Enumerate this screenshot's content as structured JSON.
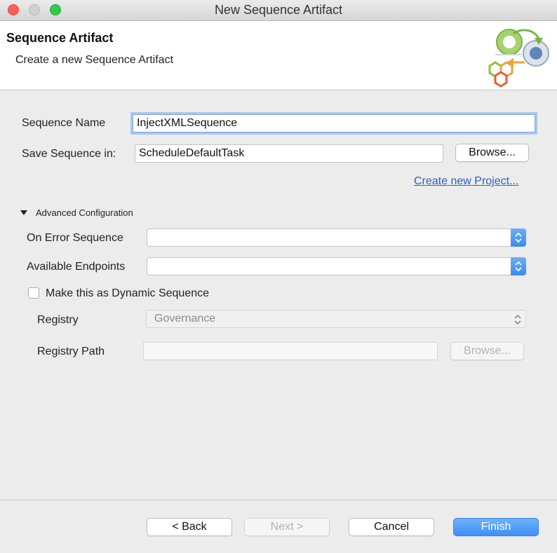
{
  "window": {
    "title": "New Sequence Artifact"
  },
  "banner": {
    "title": "Sequence Artifact",
    "subtitle": "Create a new Sequence Artifact",
    "icon": "wizard-graphic-icon"
  },
  "form": {
    "sequence_name_label": "Sequence Name",
    "sequence_name_value": "InjectXMLSequence",
    "save_in_label": "Save Sequence in:",
    "save_in_value": "ScheduleDefaultTask",
    "browse_label": "Browse...",
    "create_project_link": "Create new Project..."
  },
  "advanced": {
    "header": "Advanced Configuration",
    "on_error_label": "On Error Sequence",
    "on_error_value": "",
    "endpoints_label": "Available Endpoints",
    "endpoints_value": "",
    "dynamic_label": "Make this as Dynamic Sequence",
    "dynamic_checked": false,
    "registry_label": "Registry",
    "registry_value": "Governance",
    "registry_path_label": "Registry Path",
    "registry_path_value": "",
    "registry_browse_label": "Browse..."
  },
  "footer": {
    "back": "< Back",
    "next": "Next >",
    "cancel": "Cancel",
    "finish": "Finish"
  },
  "colors": {
    "accent": "#3d8ff7",
    "link": "#2f5fbd",
    "close": "#fc605c",
    "maximize": "#35c84a"
  }
}
